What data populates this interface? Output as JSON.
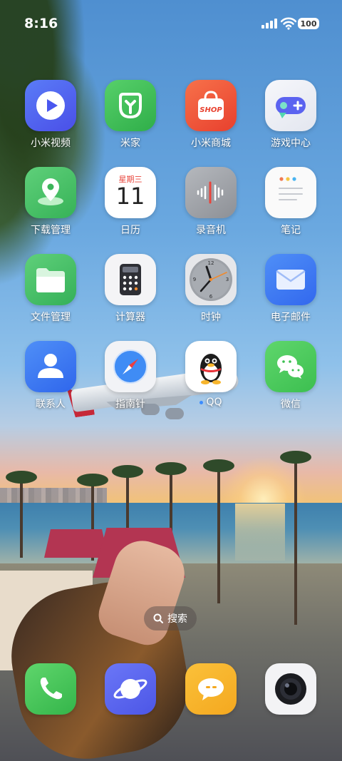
{
  "status_bar": {
    "time": "8:16",
    "battery": "100"
  },
  "apps": [
    {
      "name": "mi-video",
      "label": "小米视频"
    },
    {
      "name": "mi-home",
      "label": "米家"
    },
    {
      "name": "mi-store",
      "label": "小米商城",
      "badge_text": "SHOP"
    },
    {
      "name": "game-center",
      "label": "游戏中心"
    },
    {
      "name": "downloads",
      "label": "下载管理"
    },
    {
      "name": "calendar",
      "label": "日历",
      "weekday": "星期三",
      "day": "11"
    },
    {
      "name": "recorder",
      "label": "录音机"
    },
    {
      "name": "notes",
      "label": "笔记"
    },
    {
      "name": "file-manager",
      "label": "文件管理"
    },
    {
      "name": "calculator",
      "label": "计算器"
    },
    {
      "name": "clock",
      "label": "时钟"
    },
    {
      "name": "email",
      "label": "电子邮件"
    },
    {
      "name": "contacts",
      "label": "联系人"
    },
    {
      "name": "compass",
      "label": "指南针"
    },
    {
      "name": "qq",
      "label": "QQ"
    },
    {
      "name": "wechat",
      "label": "微信"
    }
  ],
  "search": {
    "label": "搜索"
  },
  "dock": [
    {
      "name": "phone"
    },
    {
      "name": "browser"
    },
    {
      "name": "messages"
    },
    {
      "name": "camera"
    }
  ],
  "colors": {
    "text": "#ffffff",
    "wechat": "#4cc35b",
    "email": "#3e7bf5",
    "mi-video": "#4a63f0",
    "mi-store": "#f05a3a"
  }
}
